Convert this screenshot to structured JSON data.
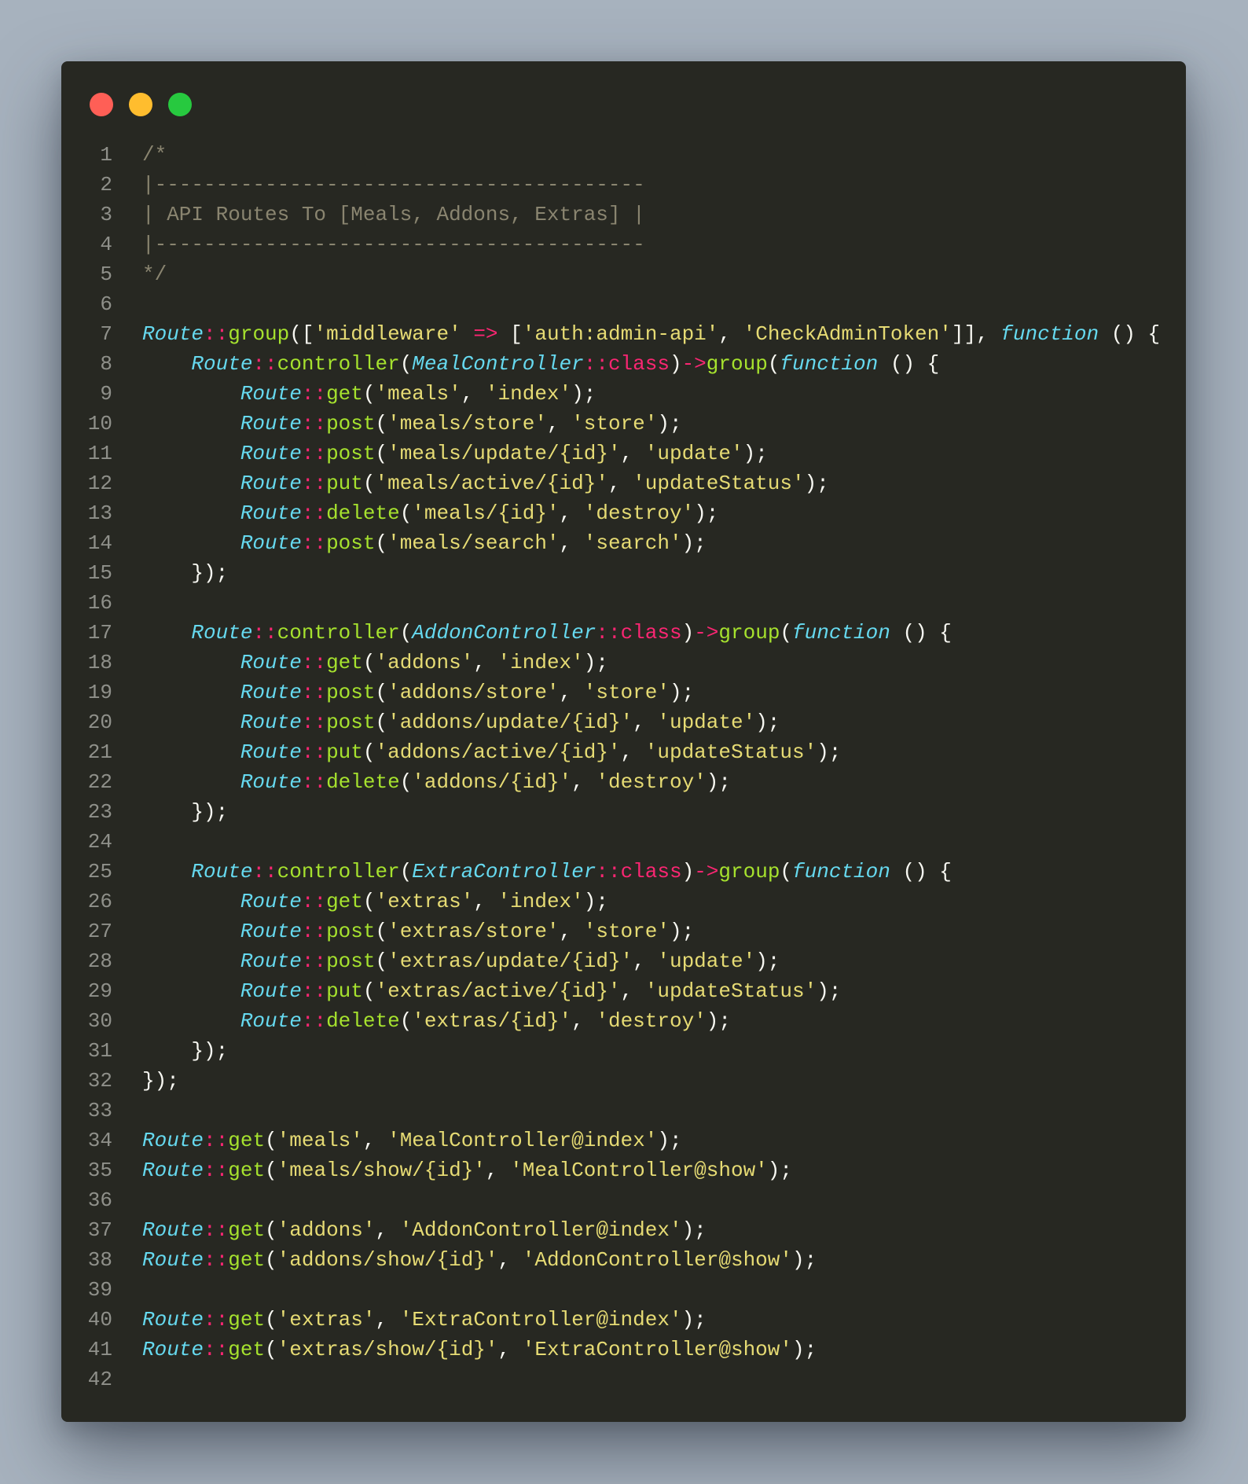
{
  "window": {
    "controls": [
      {
        "name": "close-button",
        "color": "#ff5f56"
      },
      {
        "name": "minimize-button",
        "color": "#ffbd2e"
      },
      {
        "name": "maximize-button",
        "color": "#27c93f"
      }
    ]
  },
  "theme": {
    "background": "#272822",
    "page_background": "#a7b2be"
  },
  "code": {
    "language": "php",
    "lines": [
      [
        [
          "comment",
          "/*"
        ]
      ],
      [
        [
          "comment",
          "|----------------------------------------"
        ]
      ],
      [
        [
          "comment",
          "| API Routes To [Meals, Addons, Extras] |"
        ]
      ],
      [
        [
          "comment",
          "|----------------------------------------"
        ]
      ],
      [
        [
          "comment",
          "*/"
        ]
      ],
      [],
      [
        [
          "class",
          "Route"
        ],
        [
          "op",
          "::"
        ],
        [
          "fn",
          "group"
        ],
        [
          "punc",
          "(["
        ],
        [
          "str",
          "'middleware'"
        ],
        [
          "punc",
          " "
        ],
        [
          "op",
          "=>"
        ],
        [
          "punc",
          " ["
        ],
        [
          "str",
          "'auth:admin-api'"
        ],
        [
          "punc",
          ", "
        ],
        [
          "str",
          "'CheckAdminToken'"
        ],
        [
          "punc",
          "]], "
        ],
        [
          "kw",
          "function"
        ],
        [
          "punc",
          " () {"
        ]
      ],
      [
        [
          "punc",
          "    "
        ],
        [
          "class",
          "Route"
        ],
        [
          "op",
          "::"
        ],
        [
          "fn",
          "controller"
        ],
        [
          "punc",
          "("
        ],
        [
          "class",
          "MealController"
        ],
        [
          "op",
          "::"
        ],
        [
          "const",
          "class"
        ],
        [
          "punc",
          ")"
        ],
        [
          "op",
          "->"
        ],
        [
          "fn",
          "group"
        ],
        [
          "punc",
          "("
        ],
        [
          "kw",
          "function"
        ],
        [
          "punc",
          " () {"
        ]
      ],
      [
        [
          "punc",
          "        "
        ],
        [
          "class",
          "Route"
        ],
        [
          "op",
          "::"
        ],
        [
          "fn",
          "get"
        ],
        [
          "punc",
          "("
        ],
        [
          "str",
          "'meals'"
        ],
        [
          "punc",
          ", "
        ],
        [
          "str",
          "'index'"
        ],
        [
          "punc",
          ");"
        ]
      ],
      [
        [
          "punc",
          "        "
        ],
        [
          "class",
          "Route"
        ],
        [
          "op",
          "::"
        ],
        [
          "fn",
          "post"
        ],
        [
          "punc",
          "("
        ],
        [
          "str",
          "'meals/store'"
        ],
        [
          "punc",
          ", "
        ],
        [
          "str",
          "'store'"
        ],
        [
          "punc",
          ");"
        ]
      ],
      [
        [
          "punc",
          "        "
        ],
        [
          "class",
          "Route"
        ],
        [
          "op",
          "::"
        ],
        [
          "fn",
          "post"
        ],
        [
          "punc",
          "("
        ],
        [
          "str",
          "'meals/update/{id}'"
        ],
        [
          "punc",
          ", "
        ],
        [
          "str",
          "'update'"
        ],
        [
          "punc",
          ");"
        ]
      ],
      [
        [
          "punc",
          "        "
        ],
        [
          "class",
          "Route"
        ],
        [
          "op",
          "::"
        ],
        [
          "fn",
          "put"
        ],
        [
          "punc",
          "("
        ],
        [
          "str",
          "'meals/active/{id}'"
        ],
        [
          "punc",
          ", "
        ],
        [
          "str",
          "'updateStatus'"
        ],
        [
          "punc",
          ");"
        ]
      ],
      [
        [
          "punc",
          "        "
        ],
        [
          "class",
          "Route"
        ],
        [
          "op",
          "::"
        ],
        [
          "fn",
          "delete"
        ],
        [
          "punc",
          "("
        ],
        [
          "str",
          "'meals/{id}'"
        ],
        [
          "punc",
          ", "
        ],
        [
          "str",
          "'destroy'"
        ],
        [
          "punc",
          ");"
        ]
      ],
      [
        [
          "punc",
          "        "
        ],
        [
          "class",
          "Route"
        ],
        [
          "op",
          "::"
        ],
        [
          "fn",
          "post"
        ],
        [
          "punc",
          "("
        ],
        [
          "str",
          "'meals/search'"
        ],
        [
          "punc",
          ", "
        ],
        [
          "str",
          "'search'"
        ],
        [
          "punc",
          ");"
        ]
      ],
      [
        [
          "punc",
          "    });"
        ]
      ],
      [],
      [
        [
          "punc",
          "    "
        ],
        [
          "class",
          "Route"
        ],
        [
          "op",
          "::"
        ],
        [
          "fn",
          "controller"
        ],
        [
          "punc",
          "("
        ],
        [
          "class",
          "AddonController"
        ],
        [
          "op",
          "::"
        ],
        [
          "const",
          "class"
        ],
        [
          "punc",
          ")"
        ],
        [
          "op",
          "->"
        ],
        [
          "fn",
          "group"
        ],
        [
          "punc",
          "("
        ],
        [
          "kw",
          "function"
        ],
        [
          "punc",
          " () {"
        ]
      ],
      [
        [
          "punc",
          "        "
        ],
        [
          "class",
          "Route"
        ],
        [
          "op",
          "::"
        ],
        [
          "fn",
          "get"
        ],
        [
          "punc",
          "("
        ],
        [
          "str",
          "'addons'"
        ],
        [
          "punc",
          ", "
        ],
        [
          "str",
          "'index'"
        ],
        [
          "punc",
          ");"
        ]
      ],
      [
        [
          "punc",
          "        "
        ],
        [
          "class",
          "Route"
        ],
        [
          "op",
          "::"
        ],
        [
          "fn",
          "post"
        ],
        [
          "punc",
          "("
        ],
        [
          "str",
          "'addons/store'"
        ],
        [
          "punc",
          ", "
        ],
        [
          "str",
          "'store'"
        ],
        [
          "punc",
          ");"
        ]
      ],
      [
        [
          "punc",
          "        "
        ],
        [
          "class",
          "Route"
        ],
        [
          "op",
          "::"
        ],
        [
          "fn",
          "post"
        ],
        [
          "punc",
          "("
        ],
        [
          "str",
          "'addons/update/{id}'"
        ],
        [
          "punc",
          ", "
        ],
        [
          "str",
          "'update'"
        ],
        [
          "punc",
          ");"
        ]
      ],
      [
        [
          "punc",
          "        "
        ],
        [
          "class",
          "Route"
        ],
        [
          "op",
          "::"
        ],
        [
          "fn",
          "put"
        ],
        [
          "punc",
          "("
        ],
        [
          "str",
          "'addons/active/{id}'"
        ],
        [
          "punc",
          ", "
        ],
        [
          "str",
          "'updateStatus'"
        ],
        [
          "punc",
          ");"
        ]
      ],
      [
        [
          "punc",
          "        "
        ],
        [
          "class",
          "Route"
        ],
        [
          "op",
          "::"
        ],
        [
          "fn",
          "delete"
        ],
        [
          "punc",
          "("
        ],
        [
          "str",
          "'addons/{id}'"
        ],
        [
          "punc",
          ", "
        ],
        [
          "str",
          "'destroy'"
        ],
        [
          "punc",
          ");"
        ]
      ],
      [
        [
          "punc",
          "    });"
        ]
      ],
      [],
      [
        [
          "punc",
          "    "
        ],
        [
          "class",
          "Route"
        ],
        [
          "op",
          "::"
        ],
        [
          "fn",
          "controller"
        ],
        [
          "punc",
          "("
        ],
        [
          "class",
          "ExtraController"
        ],
        [
          "op",
          "::"
        ],
        [
          "const",
          "class"
        ],
        [
          "punc",
          ")"
        ],
        [
          "op",
          "->"
        ],
        [
          "fn",
          "group"
        ],
        [
          "punc",
          "("
        ],
        [
          "kw",
          "function"
        ],
        [
          "punc",
          " () {"
        ]
      ],
      [
        [
          "punc",
          "        "
        ],
        [
          "class",
          "Route"
        ],
        [
          "op",
          "::"
        ],
        [
          "fn",
          "get"
        ],
        [
          "punc",
          "("
        ],
        [
          "str",
          "'extras'"
        ],
        [
          "punc",
          ", "
        ],
        [
          "str",
          "'index'"
        ],
        [
          "punc",
          ");"
        ]
      ],
      [
        [
          "punc",
          "        "
        ],
        [
          "class",
          "Route"
        ],
        [
          "op",
          "::"
        ],
        [
          "fn",
          "post"
        ],
        [
          "punc",
          "("
        ],
        [
          "str",
          "'extras/store'"
        ],
        [
          "punc",
          ", "
        ],
        [
          "str",
          "'store'"
        ],
        [
          "punc",
          ");"
        ]
      ],
      [
        [
          "punc",
          "        "
        ],
        [
          "class",
          "Route"
        ],
        [
          "op",
          "::"
        ],
        [
          "fn",
          "post"
        ],
        [
          "punc",
          "("
        ],
        [
          "str",
          "'extras/update/{id}'"
        ],
        [
          "punc",
          ", "
        ],
        [
          "str",
          "'update'"
        ],
        [
          "punc",
          ");"
        ]
      ],
      [
        [
          "punc",
          "        "
        ],
        [
          "class",
          "Route"
        ],
        [
          "op",
          "::"
        ],
        [
          "fn",
          "put"
        ],
        [
          "punc",
          "("
        ],
        [
          "str",
          "'extras/active/{id}'"
        ],
        [
          "punc",
          ", "
        ],
        [
          "str",
          "'updateStatus'"
        ],
        [
          "punc",
          ");"
        ]
      ],
      [
        [
          "punc",
          "        "
        ],
        [
          "class",
          "Route"
        ],
        [
          "op",
          "::"
        ],
        [
          "fn",
          "delete"
        ],
        [
          "punc",
          "("
        ],
        [
          "str",
          "'extras/{id}'"
        ],
        [
          "punc",
          ", "
        ],
        [
          "str",
          "'destroy'"
        ],
        [
          "punc",
          ");"
        ]
      ],
      [
        [
          "punc",
          "    });"
        ]
      ],
      [
        [
          "punc",
          "});"
        ]
      ],
      [],
      [
        [
          "class",
          "Route"
        ],
        [
          "op",
          "::"
        ],
        [
          "fn",
          "get"
        ],
        [
          "punc",
          "("
        ],
        [
          "str",
          "'meals'"
        ],
        [
          "punc",
          ", "
        ],
        [
          "str",
          "'MealController@index'"
        ],
        [
          "punc",
          ");"
        ]
      ],
      [
        [
          "class",
          "Route"
        ],
        [
          "op",
          "::"
        ],
        [
          "fn",
          "get"
        ],
        [
          "punc",
          "("
        ],
        [
          "str",
          "'meals/show/{id}'"
        ],
        [
          "punc",
          ", "
        ],
        [
          "str",
          "'MealController@show'"
        ],
        [
          "punc",
          ");"
        ]
      ],
      [],
      [
        [
          "class",
          "Route"
        ],
        [
          "op",
          "::"
        ],
        [
          "fn",
          "get"
        ],
        [
          "punc",
          "("
        ],
        [
          "str",
          "'addons'"
        ],
        [
          "punc",
          ", "
        ],
        [
          "str",
          "'AddonController@index'"
        ],
        [
          "punc",
          ");"
        ]
      ],
      [
        [
          "class",
          "Route"
        ],
        [
          "op",
          "::"
        ],
        [
          "fn",
          "get"
        ],
        [
          "punc",
          "("
        ],
        [
          "str",
          "'addons/show/{id}'"
        ],
        [
          "punc",
          ", "
        ],
        [
          "str",
          "'AddonController@show'"
        ],
        [
          "punc",
          ");"
        ]
      ],
      [],
      [
        [
          "class",
          "Route"
        ],
        [
          "op",
          "::"
        ],
        [
          "fn",
          "get"
        ],
        [
          "punc",
          "("
        ],
        [
          "str",
          "'extras'"
        ],
        [
          "punc",
          ", "
        ],
        [
          "str",
          "'ExtraController@index'"
        ],
        [
          "punc",
          ");"
        ]
      ],
      [
        [
          "class",
          "Route"
        ],
        [
          "op",
          "::"
        ],
        [
          "fn",
          "get"
        ],
        [
          "punc",
          "("
        ],
        [
          "str",
          "'extras/show/{id}'"
        ],
        [
          "punc",
          ", "
        ],
        [
          "str",
          "'ExtraController@show'"
        ],
        [
          "punc",
          ");"
        ]
      ],
      []
    ]
  }
}
